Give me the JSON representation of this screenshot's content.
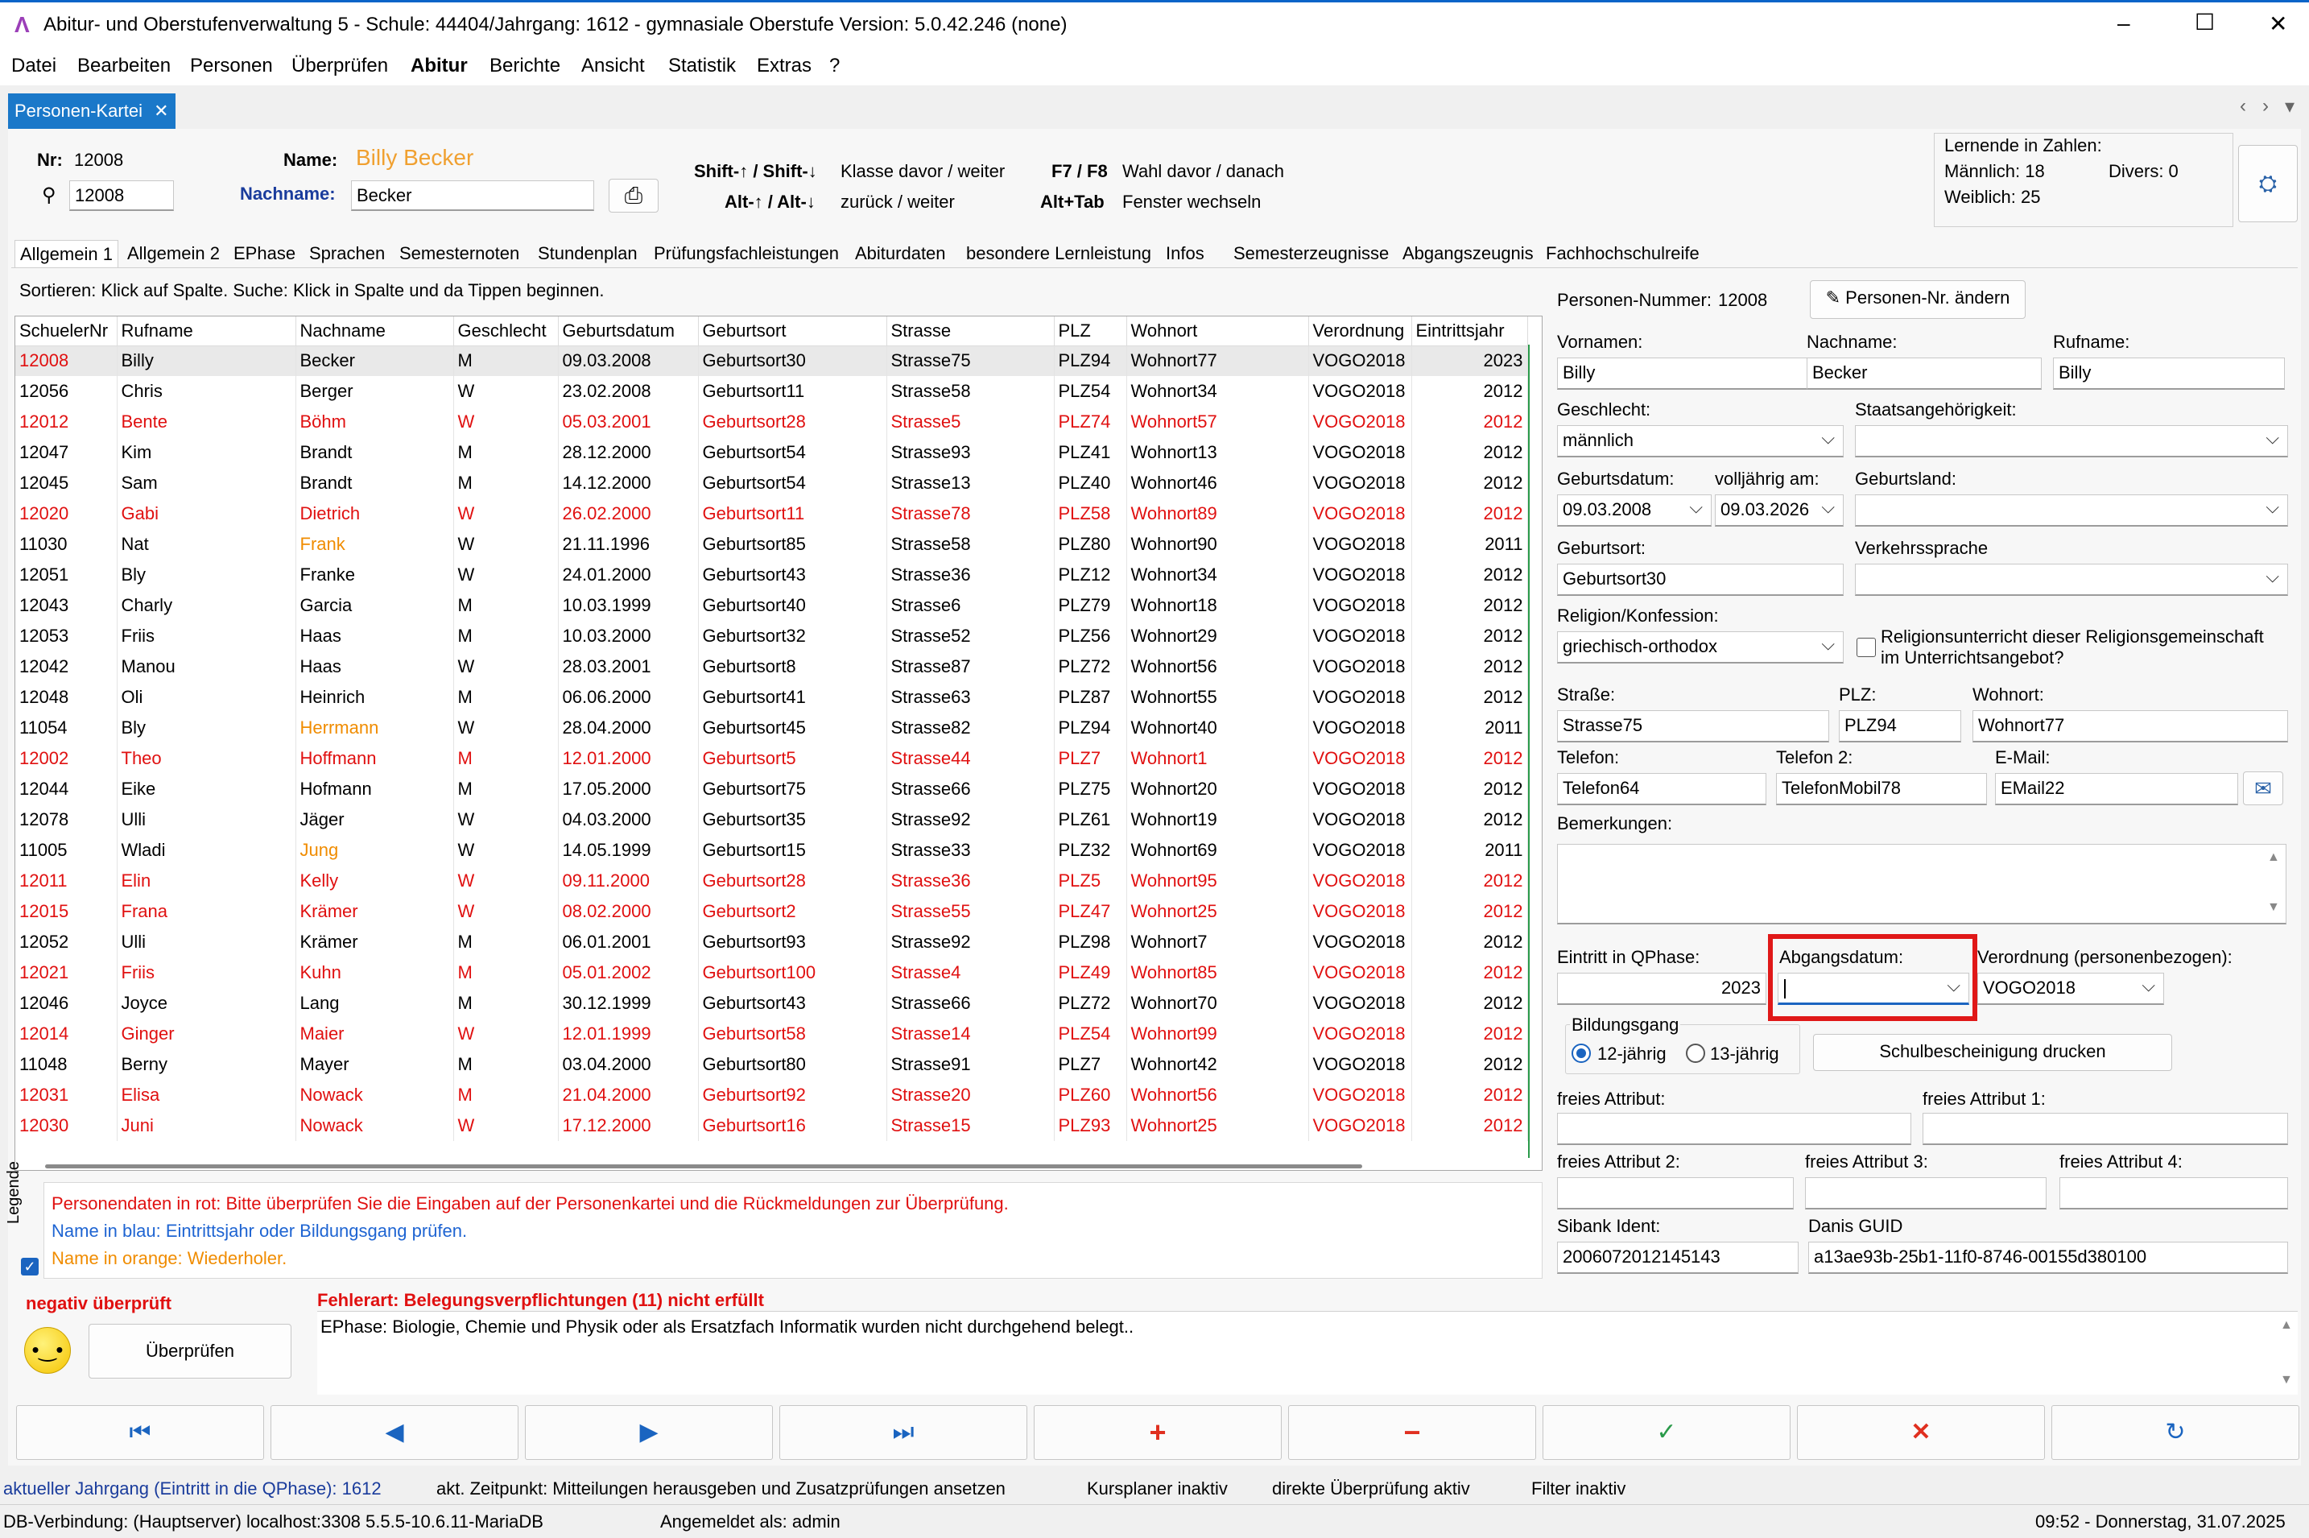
{
  "window": {
    "title": "Abitur- und Oberstufenverwaltung 5 - Schule: 44404/Jahrgang: 1612 - gymnasiale Oberstufe Version: 5.0.42.246 (none)",
    "minimize": "–",
    "maximize": "☐",
    "close": "✕"
  },
  "menu": [
    "Datei",
    "Bearbeiten",
    "Personen",
    "Überprüfen",
    "Abitur",
    "Berichte",
    "Ansicht",
    "Statistik",
    "Extras",
    "?"
  ],
  "doc_tab": {
    "label": "Personen-Kartei",
    "close": "✕"
  },
  "tab_arrows": {
    "left": "‹",
    "right": "›",
    "down": "▾"
  },
  "header": {
    "nr_label": "Nr:",
    "nr_value": "12008",
    "search_value": "12008",
    "name_label": "Name:",
    "name_value": "Billy Becker",
    "nachname_label": "Nachname:",
    "nachname_value": "Becker",
    "shortcut1_key": "Shift-↑ / Shift-↓",
    "shortcut1_desc": "Klasse davor / weiter",
    "shortcut2_key": "Alt-↑ / Alt-↓",
    "shortcut2_desc": "zurück / weiter",
    "shortcut3_key": "F7 / F8",
    "shortcut3_desc": "Wahl davor / danach",
    "shortcut4_key": "Alt+Tab",
    "shortcut4_desc": "Fenster wechseln"
  },
  "counts": {
    "title": "Lernende in Zahlen:",
    "maennlich": "Männlich: 18",
    "weiblich": "Weiblich: 25",
    "divers": "Divers: 0"
  },
  "page_tabs": [
    "Allgemein 1",
    "Allgemein 2",
    "EPhase",
    "Sprachen",
    "Semesternoten",
    "Stundenplan",
    "Prüfungsfachleistungen",
    "Abiturdaten",
    "besondere Lernleistung",
    "Infos",
    "Semesterzeugnisse",
    "Abgangszeugnis",
    "Fachhochschulreife"
  ],
  "sort_hint": "Sortieren: Klick auf Spalte. Suche: Klick in Spalte und da Tippen beginnen.",
  "table": {
    "columns": [
      "SchuelerNr",
      "Rufname",
      "Nachname",
      "Geschlecht",
      "Geburtsdatum",
      "Geburtsort",
      "Strasse",
      "PLZ",
      "Wohnort",
      "Verordnung",
      "Eintrittsjahr"
    ],
    "rows": [
      {
        "c": [
          "12008",
          "Billy",
          "Becker",
          "M",
          "09.03.2008",
          "Geburtsort30",
          "Strasse75",
          "PLZ94",
          "Wohnort77",
          "VOGO2018",
          "2023"
        ],
        "style": "mixed",
        "sel": true
      },
      {
        "c": [
          "12056",
          "Chris",
          "Berger",
          "W",
          "23.02.2008",
          "Geburtsort11",
          "Strasse58",
          "PLZ54",
          "Wohnort34",
          "VOGO2018",
          "2012"
        ],
        "style": "normal"
      },
      {
        "c": [
          "12012",
          "Bente",
          "Böhm",
          "W",
          "05.03.2001",
          "Geburtsort28",
          "Strasse5",
          "PLZ74",
          "Wohnort57",
          "VOGO2018",
          "2012"
        ],
        "style": "red"
      },
      {
        "c": [
          "12047",
          "Kim",
          "Brandt",
          "M",
          "28.12.2000",
          "Geburtsort54",
          "Strasse93",
          "PLZ41",
          "Wohnort13",
          "VOGO2018",
          "2012"
        ],
        "style": "normal"
      },
      {
        "c": [
          "12045",
          "Sam",
          "Brandt",
          "M",
          "14.12.2000",
          "Geburtsort54",
          "Strasse13",
          "PLZ40",
          "Wohnort46",
          "VOGO2018",
          "2012"
        ],
        "style": "normal"
      },
      {
        "c": [
          "12020",
          "Gabi",
          "Dietrich",
          "W",
          "26.02.2000",
          "Geburtsort11",
          "Strasse78",
          "PLZ58",
          "Wohnort89",
          "VOGO2018",
          "2012"
        ],
        "style": "red"
      },
      {
        "c": [
          "11030",
          "Nat",
          "Frank",
          "W",
          "21.11.1996",
          "Geburtsort85",
          "Strasse58",
          "PLZ80",
          "Wohnort90",
          "VOGO2018",
          "2011"
        ],
        "style": "orange"
      },
      {
        "c": [
          "12051",
          "Bly",
          "Franke",
          "W",
          "24.01.2000",
          "Geburtsort43",
          "Strasse36",
          "PLZ12",
          "Wohnort34",
          "VOGO2018",
          "2012"
        ],
        "style": "normal"
      },
      {
        "c": [
          "12043",
          "Charly",
          "Garcia",
          "M",
          "10.03.1999",
          "Geburtsort40",
          "Strasse6",
          "PLZ79",
          "Wohnort18",
          "VOGO2018",
          "2012"
        ],
        "style": "normal"
      },
      {
        "c": [
          "12053",
          "Friis",
          "Haas",
          "M",
          "10.03.2000",
          "Geburtsort32",
          "Strasse52",
          "PLZ56",
          "Wohnort29",
          "VOGO2018",
          "2012"
        ],
        "style": "normal"
      },
      {
        "c": [
          "12042",
          "Manou",
          "Haas",
          "W",
          "28.03.2001",
          "Geburtsort8",
          "Strasse87",
          "PLZ72",
          "Wohnort56",
          "VOGO2018",
          "2012"
        ],
        "style": "normal"
      },
      {
        "c": [
          "12048",
          "Oli",
          "Heinrich",
          "M",
          "06.06.2000",
          "Geburtsort41",
          "Strasse63",
          "PLZ87",
          "Wohnort55",
          "VOGO2018",
          "2012"
        ],
        "style": "normal"
      },
      {
        "c": [
          "11054",
          "Bly",
          "Herrmann",
          "W",
          "28.04.2000",
          "Geburtsort45",
          "Strasse82",
          "PLZ94",
          "Wohnort40",
          "VOGO2018",
          "2011"
        ],
        "style": "orange"
      },
      {
        "c": [
          "12002",
          "Theo",
          "Hoffmann",
          "M",
          "12.01.2000",
          "Geburtsort5",
          "Strasse44",
          "PLZ7",
          "Wohnort1",
          "VOGO2018",
          "2012"
        ],
        "style": "red"
      },
      {
        "c": [
          "12044",
          "Eike",
          "Hofmann",
          "M",
          "17.05.2000",
          "Geburtsort75",
          "Strasse66",
          "PLZ75",
          "Wohnort20",
          "VOGO2018",
          "2012"
        ],
        "style": "normal"
      },
      {
        "c": [
          "12078",
          "Ulli",
          "Jäger",
          "W",
          "04.03.2000",
          "Geburtsort35",
          "Strasse92",
          "PLZ61",
          "Wohnort19",
          "VOGO2018",
          "2012"
        ],
        "style": "normal"
      },
      {
        "c": [
          "11005",
          "Wladi",
          "Jung",
          "W",
          "14.05.1999",
          "Geburtsort15",
          "Strasse33",
          "PLZ32",
          "Wohnort69",
          "VOGO2018",
          "2011"
        ],
        "style": "orange"
      },
      {
        "c": [
          "12011",
          "Elin",
          "Kelly",
          "W",
          "09.11.2000",
          "Geburtsort28",
          "Strasse36",
          "PLZ5",
          "Wohnort95",
          "VOGO2018",
          "2012"
        ],
        "style": "red"
      },
      {
        "c": [
          "12015",
          "Frana",
          "Krämer",
          "W",
          "08.02.2000",
          "Geburtsort2",
          "Strasse55",
          "PLZ47",
          "Wohnort25",
          "VOGO2018",
          "2012"
        ],
        "style": "red"
      },
      {
        "c": [
          "12052",
          "Ulli",
          "Krämer",
          "M",
          "06.01.2001",
          "Geburtsort93",
          "Strasse92",
          "PLZ98",
          "Wohnort7",
          "VOGO2018",
          "2012"
        ],
        "style": "normal"
      },
      {
        "c": [
          "12021",
          "Friis",
          "Kuhn",
          "M",
          "05.01.2002",
          "Geburtsort100",
          "Strasse4",
          "PLZ49",
          "Wohnort85",
          "VOGO2018",
          "2012"
        ],
        "style": "red"
      },
      {
        "c": [
          "12046",
          "Joyce",
          "Lang",
          "M",
          "30.12.1999",
          "Geburtsort43",
          "Strasse66",
          "PLZ72",
          "Wohnort70",
          "VOGO2018",
          "2012"
        ],
        "style": "normal"
      },
      {
        "c": [
          "12014",
          "Ginger",
          "Maier",
          "W",
          "12.01.1999",
          "Geburtsort58",
          "Strasse14",
          "PLZ54",
          "Wohnort99",
          "VOGO2018",
          "2012"
        ],
        "style": "red"
      },
      {
        "c": [
          "11048",
          "Berny",
          "Mayer",
          "M",
          "03.04.2000",
          "Geburtsort80",
          "Strasse91",
          "PLZ7",
          "Wohnort42",
          "VOGO2018",
          "2012"
        ],
        "style": "normal"
      },
      {
        "c": [
          "12031",
          "Elisa",
          "Nowack",
          "M",
          "21.04.2000",
          "Geburtsort92",
          "Strasse20",
          "PLZ60",
          "Wohnort56",
          "VOGO2018",
          "2012"
        ],
        "style": "red"
      },
      {
        "c": [
          "12030",
          "Juni",
          "Nowack",
          "W",
          "17.12.2000",
          "Geburtsort16",
          "Strasse15",
          "PLZ93",
          "Wohnort25",
          "VOGO2018",
          "2012"
        ],
        "style": "red"
      }
    ]
  },
  "legend": {
    "title": "Legende",
    "red": "Personendaten in rot: Bitte überprüfen Sie die Eingaben auf der Personenkartei und die Rückmeldungen zur Überprüfung.",
    "blue": "Name in blau: Eintrittsjahr oder Bildungsgang prüfen.",
    "orange": "Name in orange: Wiederholer.",
    "colors": {
      "red": "#e01010",
      "blue": "#1e64d2",
      "orange": "#f08c00"
    }
  },
  "form": {
    "personen_nr_label": "Personen-Nummer:",
    "personen_nr_value": "12008",
    "change_nr_button": "Personen-Nr. ändern",
    "vornamen_label": "Vornamen:",
    "vornamen_value": "Billy",
    "nachname_label": "Nachname:",
    "nachname_value": "Becker",
    "rufname_label": "Rufname:",
    "rufname_value": "Billy",
    "geschlecht_label": "Geschlecht:",
    "geschlecht_value": "männlich",
    "staatsang_label": "Staatsangehörigkeit:",
    "staatsang_value": "",
    "geburtsdatum_label": "Geburtsdatum:",
    "geburtsdatum_value": "09.03.2008",
    "volljaehrig_label": "volljährig am:",
    "volljaehrig_value": "09.03.2026",
    "geburtsland_label": "Geburtsland:",
    "geburtsland_value": "",
    "geburtsort_label": "Geburtsort:",
    "geburtsort_value": "Geburtsort30",
    "verkehrssprache_label": "Verkehrssprache",
    "verkehrssprache_value": "",
    "religion_label": "Religion/Konfession:",
    "religion_value": "griechisch-orthodox",
    "religion_check_label": "Religionsunterricht dieser Religionsgemeinschaft im Unterrichtsangebot?",
    "strasse_label": "Straße:",
    "strasse_value": "Strasse75",
    "plz_label": "PLZ:",
    "plz_value": "PLZ94",
    "wohnort_label": "Wohnort:",
    "wohnort_value": "Wohnort77",
    "telefon_label": "Telefon:",
    "telefon_value": "Telefon64",
    "telefon2_label": "Telefon 2:",
    "telefon2_value": "TelefonMobil78",
    "email_label": "E-Mail:",
    "email_value": "EMail22",
    "bemerkungen_label": "Bemerkungen:",
    "bemerkungen_value": "",
    "eintritt_label": "Eintritt in QPhase:",
    "eintritt_value": "2023",
    "abgang_label": "Abgangsdatum:",
    "abgang_value": "",
    "verordnung_label": "Verordnung (personenbezogen):",
    "verordnung_value": "VOGO2018",
    "bildungsgang_label": "Bildungsgang",
    "bg12_label": "12-jährig",
    "bg13_label": "13-jährig",
    "schulbescheinigung_button": "Schulbescheinigung drucken",
    "attr_label": "freies Attribut:",
    "attr1_label": "freies Attribut 1:",
    "attr2_label": "freies Attribut 2:",
    "attr3_label": "freies Attribut 3:",
    "attr4_label": "freies Attribut 4:",
    "sibank_label": "Sibank Ident:",
    "sibank_value": "2006072012145143",
    "danis_label": "Danis GUID",
    "danis_value": "a13ae93b-25b1-11f0-8746-00155d380100"
  },
  "check": {
    "status": "negativ überprüft",
    "button": "Überprüfen",
    "error_title": "Fehlerart: Belegungsverpflichtungen (11) nicht erfüllt",
    "error_text": "EPhase: Biologie, Chemie und Physik oder als Ersatzfach Informatik wurden nicht durchgehend belegt.."
  },
  "nav": {
    "first": "⏮",
    "prev": "◀",
    "next": "▶",
    "last": "⏭",
    "add": "+",
    "remove": "−",
    "save": "✓",
    "cancel": "✕",
    "refresh": "↻"
  },
  "status": {
    "jahrgang": "aktueller Jahrgang (Eintritt in die QPhase): 1612",
    "zeitpunkt": "akt. Zeitpunkt: Mitteilungen herausgeben und Zusatzprüfungen ansetzen",
    "kursplaner": "Kursplaner inaktiv",
    "ueberpruefung": "direkte Überprüfung aktiv",
    "filter": "Filter inaktiv",
    "db": "DB-Verbindung: (Hauptserver) localhost:3308 5.5.5-10.6.11-MariaDB",
    "user": "Angemeldet als: admin",
    "clock": "09:52 - Donnerstag, 31.07.2025"
  }
}
